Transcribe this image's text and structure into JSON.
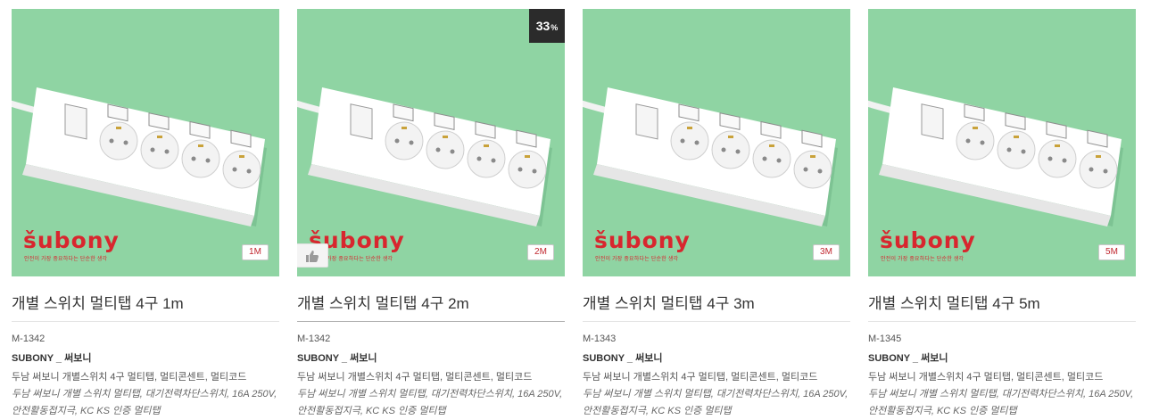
{
  "colors": {
    "thumbnail_bg": "#8fd4a3",
    "brand_red": "#d8262e",
    "sale_badge_bg": "#2b2b2b"
  },
  "products": [
    {
      "brand_logo": "šubony",
      "brand_tagline": "안전이 가장 중요하다는 단순한 생각",
      "length_badge": "1M",
      "sale_percent": "",
      "title": "개별 스위치 멀티탭 4구 1m",
      "code": "M-1342",
      "maker": "SUBONY _ 써보니",
      "tags": "두남 써보니 개별스위치 4구 멀티탭, 멀티콘센트, 멀티코드",
      "description": "두남 써보니 개별 스위치 멀티탭, 대기전력차단스위치, 16A 250V, 안전활동접지극, KC KS 인증 멀티탭"
    },
    {
      "brand_logo": "šubony",
      "brand_tagline": "안전이 가장 중요하다는 단순한 생각",
      "length_badge": "2M",
      "sale_percent": "33",
      "sale_unit": "%",
      "title": "개별 스위치 멀티탭 4구 2m",
      "code": "M-1342",
      "maker": "SUBONY _ 써보니",
      "tags": "두남 써보니 개별스위치 4구 멀티탭, 멀티콘센트, 멀티코드",
      "description": "두남 써보니 개별 스위치 멀티탭, 대기전력차단스위치, 16A 250V, 안전활동접지극, KC KS 인증 멀티탭"
    },
    {
      "brand_logo": "šubony",
      "brand_tagline": "안전이 가장 중요하다는 단순한 생각",
      "length_badge": "3M",
      "sale_percent": "",
      "title": "개별 스위치 멀티탭 4구 3m",
      "code": "M-1343",
      "maker": "SUBONY _ 써보니",
      "tags": "두남 써보니 개별스위치 4구 멀티탭, 멀티콘센트, 멀티코드",
      "description": "두남 써보니 개별 스위치 멀티탭, 대기전력차단스위치, 16A 250V, 안전활동접지극, KC KS 인증 멀티탭"
    },
    {
      "brand_logo": "šubony",
      "brand_tagline": "안전이 가장 중요하다는 단순한 생각",
      "length_badge": "5M",
      "sale_percent": "",
      "title": "개별 스위치 멀티탭 4구 5m",
      "code": "M-1345",
      "maker": "SUBONY _ 써보니",
      "tags": "두남 써보니 개별스위치 4구 멀티탭, 멀티콘센트, 멀티코드",
      "description": "두남 써보니 개별 스위치 멀티탭, 대기전력차단스위치, 16A 250V, 안전활동접지극, KC KS 인증 멀티탭"
    }
  ]
}
